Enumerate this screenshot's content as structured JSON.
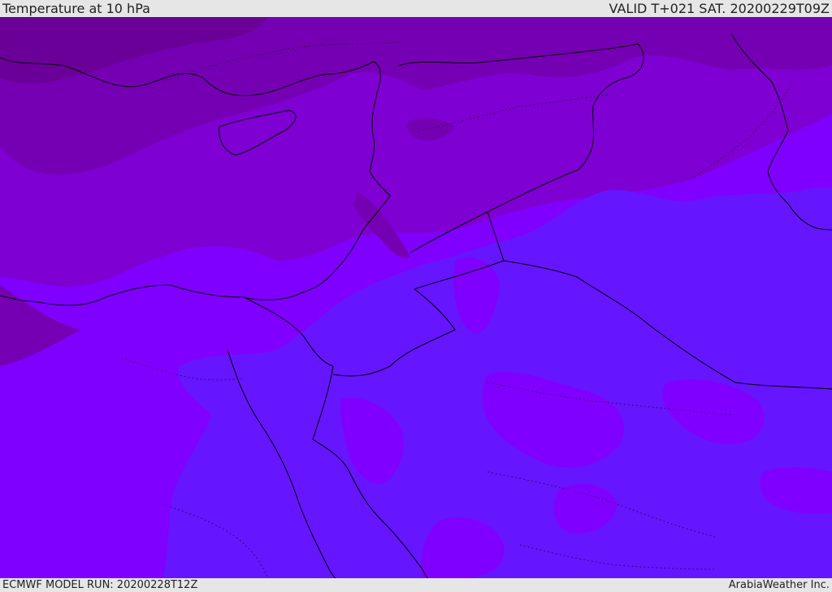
{
  "header": {
    "title": "Temperature at 10 hPa",
    "valid_time": "VALID T+021 SAT. 20200229T09Z"
  },
  "footer": {
    "model_run": "ECMWF MODEL RUN: 20200228T12Z",
    "credit": "ArabiaWeather Inc."
  },
  "map": {
    "colors": {
      "cold_darkest": "#6a0098",
      "cold_dark": "#7500b3",
      "cold_mid": "#7f00d2",
      "violet": "#8000ff",
      "blue_violet": "#6615ff",
      "coastline": "#000000"
    }
  }
}
